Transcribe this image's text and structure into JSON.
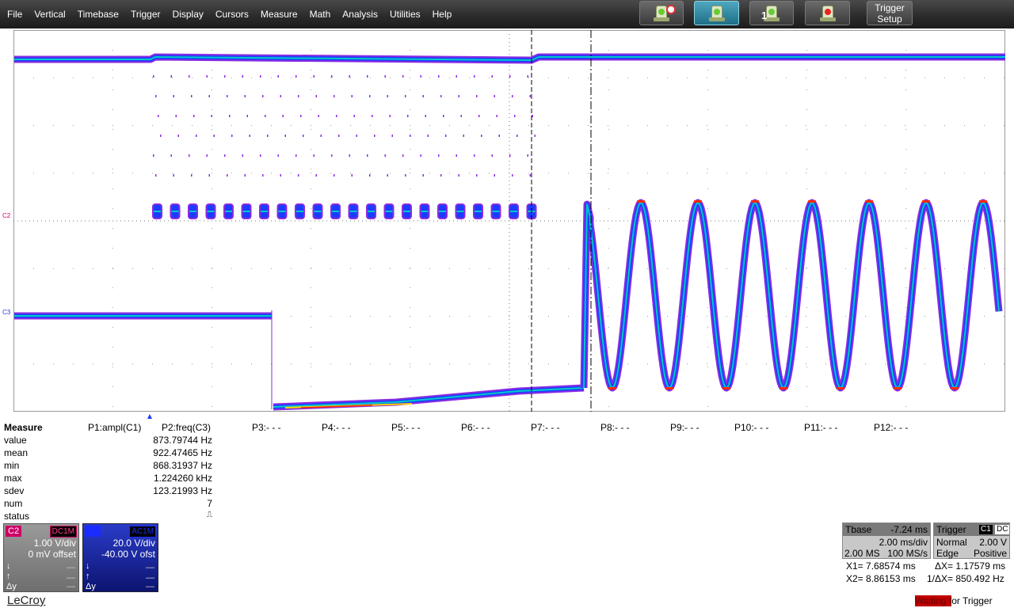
{
  "menu": [
    "File",
    "Vertical",
    "Timebase",
    "Trigger",
    "Display",
    "Cursors",
    "Measure",
    "Math",
    "Analysis",
    "Utilities",
    "Help"
  ],
  "toolbar": {
    "trigger_setup_line1": "Trigger",
    "trigger_setup_line2": "Setup",
    "single_digit": "1",
    "buttons": [
      "auto-trigger-icon",
      "normal-trigger-icon",
      "single-trigger-icon",
      "stop-trigger-icon"
    ]
  },
  "scope": {
    "channel_markers": [
      "C2",
      "C3"
    ],
    "colors": {
      "c2": "#cc0066",
      "c3": "#2233dd",
      "persistence": [
        "#8a2be2",
        "#1a3cff",
        "#00c8c8",
        "#ffd200",
        "#ff2a00"
      ]
    }
  },
  "measure": {
    "title": "Measure",
    "row_labels": [
      "value",
      "mean",
      "min",
      "max",
      "sdev",
      "num",
      "status"
    ],
    "params": [
      "P1:ampl(C1)",
      "P2:freq(C3)",
      "P3:- - -",
      "P4:- - -",
      "P5:- - -",
      "P6:- - -",
      "P7:- - -",
      "P8:- - -",
      "P9:- - -",
      "P10:- - -",
      "P11:- - -",
      "P12:- - -"
    ],
    "p2_values": [
      "873.79744 Hz",
      "922.47465 Hz",
      "868.31937 Hz",
      "1.224260 kHz",
      "123.21993 Hz",
      "7",
      "⎍"
    ]
  },
  "channels": [
    {
      "name": "C2",
      "coupling": "DC1M",
      "vdiv": "1.00 V/div",
      "offset": "0 mV offset",
      "color": "#cc0066"
    },
    {
      "name": "C3",
      "coupling": "AC1M",
      "vdiv": "20.0 V/div",
      "offset": "-40.00 V ofst",
      "color": "#2222dd"
    }
  ],
  "channel_controls": [
    "↓",
    "↑",
    "Δy"
  ],
  "brand": "LeCroy",
  "timebase": {
    "label": "Tbase",
    "delay": "-7.24 ms",
    "tdiv": "2.00 ms/div",
    "samples": "2.00 MS",
    "rate": "100 MS/s"
  },
  "trigger": {
    "label": "Trigger",
    "source": "C1",
    "coupling": "DC",
    "mode": "Normal",
    "level": "2.00 V",
    "type": "Edge",
    "slope": "Positive"
  },
  "cursors": {
    "x1": "X1=  7.68574 ms",
    "dx": "ΔX=  1.17579 ms",
    "x2": "X2=  8.86153 ms",
    "inv_dx": "1/ΔX=   850.492 Hz"
  },
  "status": {
    "highlight": "Waiting f",
    "rest": "or Trigger"
  }
}
